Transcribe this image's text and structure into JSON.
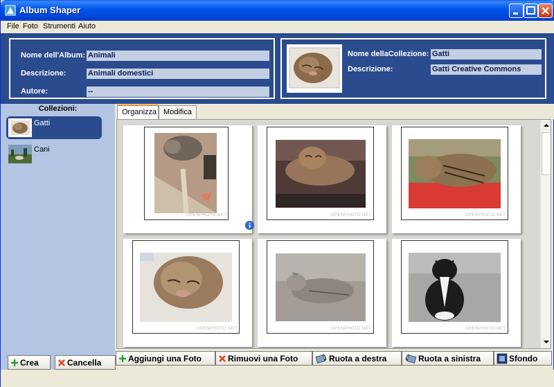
{
  "window": {
    "title": "Album Shaper"
  },
  "menu": [
    "File",
    "Foto",
    "Strumenti",
    "Aiuto"
  ],
  "album": {
    "name_label": "Nome dell'Album:",
    "name_value": "Animali",
    "desc_label": "Descrizione:",
    "desc_value": "Animali domestici",
    "author_label": "Autore:",
    "author_value": "--"
  },
  "collection": {
    "name_label": "Nome dellaCollezione:",
    "name_value": "Gatti",
    "desc_label": "Descrizione:",
    "desc_value": "Gatti Creative Commons"
  },
  "sidebar": {
    "title": "Collezioni:",
    "items": [
      {
        "label": "Gatti",
        "selected": true
      },
      {
        "label": "Cani",
        "selected": false
      }
    ],
    "create_label": "Crea",
    "cancel_label": "Cancella"
  },
  "tabs": [
    {
      "label": "Organizza",
      "active": true
    },
    {
      "label": "Modifica",
      "active": false
    }
  ],
  "photos": {
    "watermark": "OPENPHOTO.NET"
  },
  "toolbar": {
    "add_photo": "Aggiungi una Foto",
    "remove_photo": "Rimuovi una Foto",
    "rotate_right": "Ruota a destra",
    "rotate_left": "Ruota a sinistra",
    "background": "Sfondo"
  },
  "colors": {
    "header_bg": "#2a4b8d",
    "sidebar_bg": "#b4c5e4",
    "field_bg": "#c4cfe3"
  }
}
